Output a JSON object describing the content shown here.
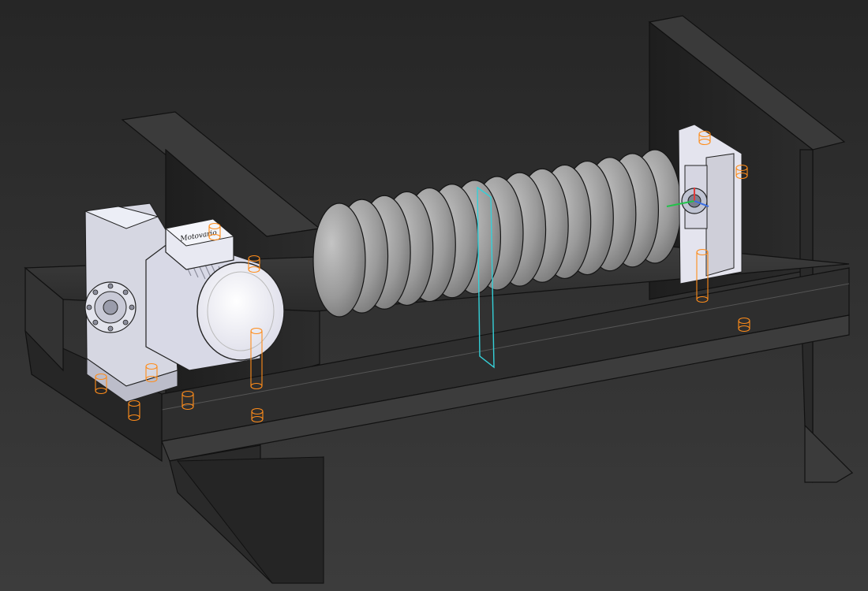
{
  "viewport": {
    "background_top": "#262626",
    "background_bottom": "#3c3c3c"
  },
  "scene": {
    "description_free": true,
    "motor": {
      "brand_text": "Motovario",
      "body_color": "#e6e6f0"
    },
    "gearbox": {
      "body_color": "#dcdce6"
    },
    "steel_color": "#333333",
    "screw_color": "#8f8f8f",
    "fastener_color": "#ff8c1a",
    "section_plane_color": "#35d0d8",
    "screw_flight_count": 15,
    "bolt_count": 12
  }
}
